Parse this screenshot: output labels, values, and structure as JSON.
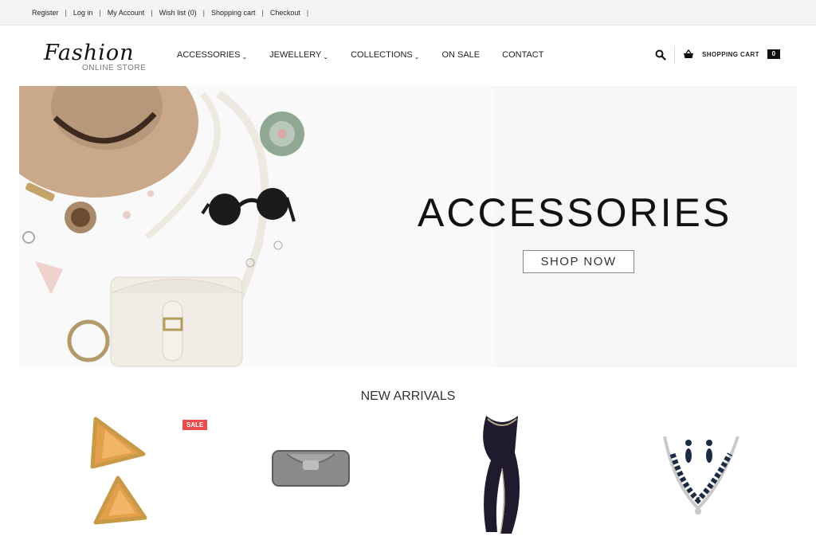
{
  "topbar": {
    "links": [
      "Register",
      "Log in",
      "My Account",
      "Wish list (0)",
      "Shopping cart",
      "Checkout"
    ]
  },
  "logo": {
    "script": "Fashion",
    "sub": "ONLINE STORE"
  },
  "nav": {
    "items": [
      {
        "label": "ACCESSORIES",
        "dropdown": true
      },
      {
        "label": "JEWELLERY",
        "dropdown": true
      },
      {
        "label": "COLLECTIONS",
        "dropdown": true
      },
      {
        "label": "ON SALE",
        "dropdown": false
      },
      {
        "label": "CONTACT",
        "dropdown": false
      }
    ]
  },
  "cart": {
    "label": "SHOPPING CART",
    "count": "0"
  },
  "hero": {
    "title": "ACCESSORIES",
    "button": "SHOP NOW"
  },
  "new_arrivals": {
    "title": "NEW ARRIVALS",
    "sale_badge": "SALE",
    "products": [
      {
        "icon": "triangle-earrings-image",
        "sale": true
      },
      {
        "icon": "beaded-clutch-image",
        "sale": false
      },
      {
        "icon": "scarf-image",
        "sale": false
      },
      {
        "icon": "necklace-set-image",
        "sale": false
      }
    ]
  },
  "colors": {
    "sale": "#e84c4c",
    "text": "#222222",
    "topbar": "#f4f4f4"
  }
}
